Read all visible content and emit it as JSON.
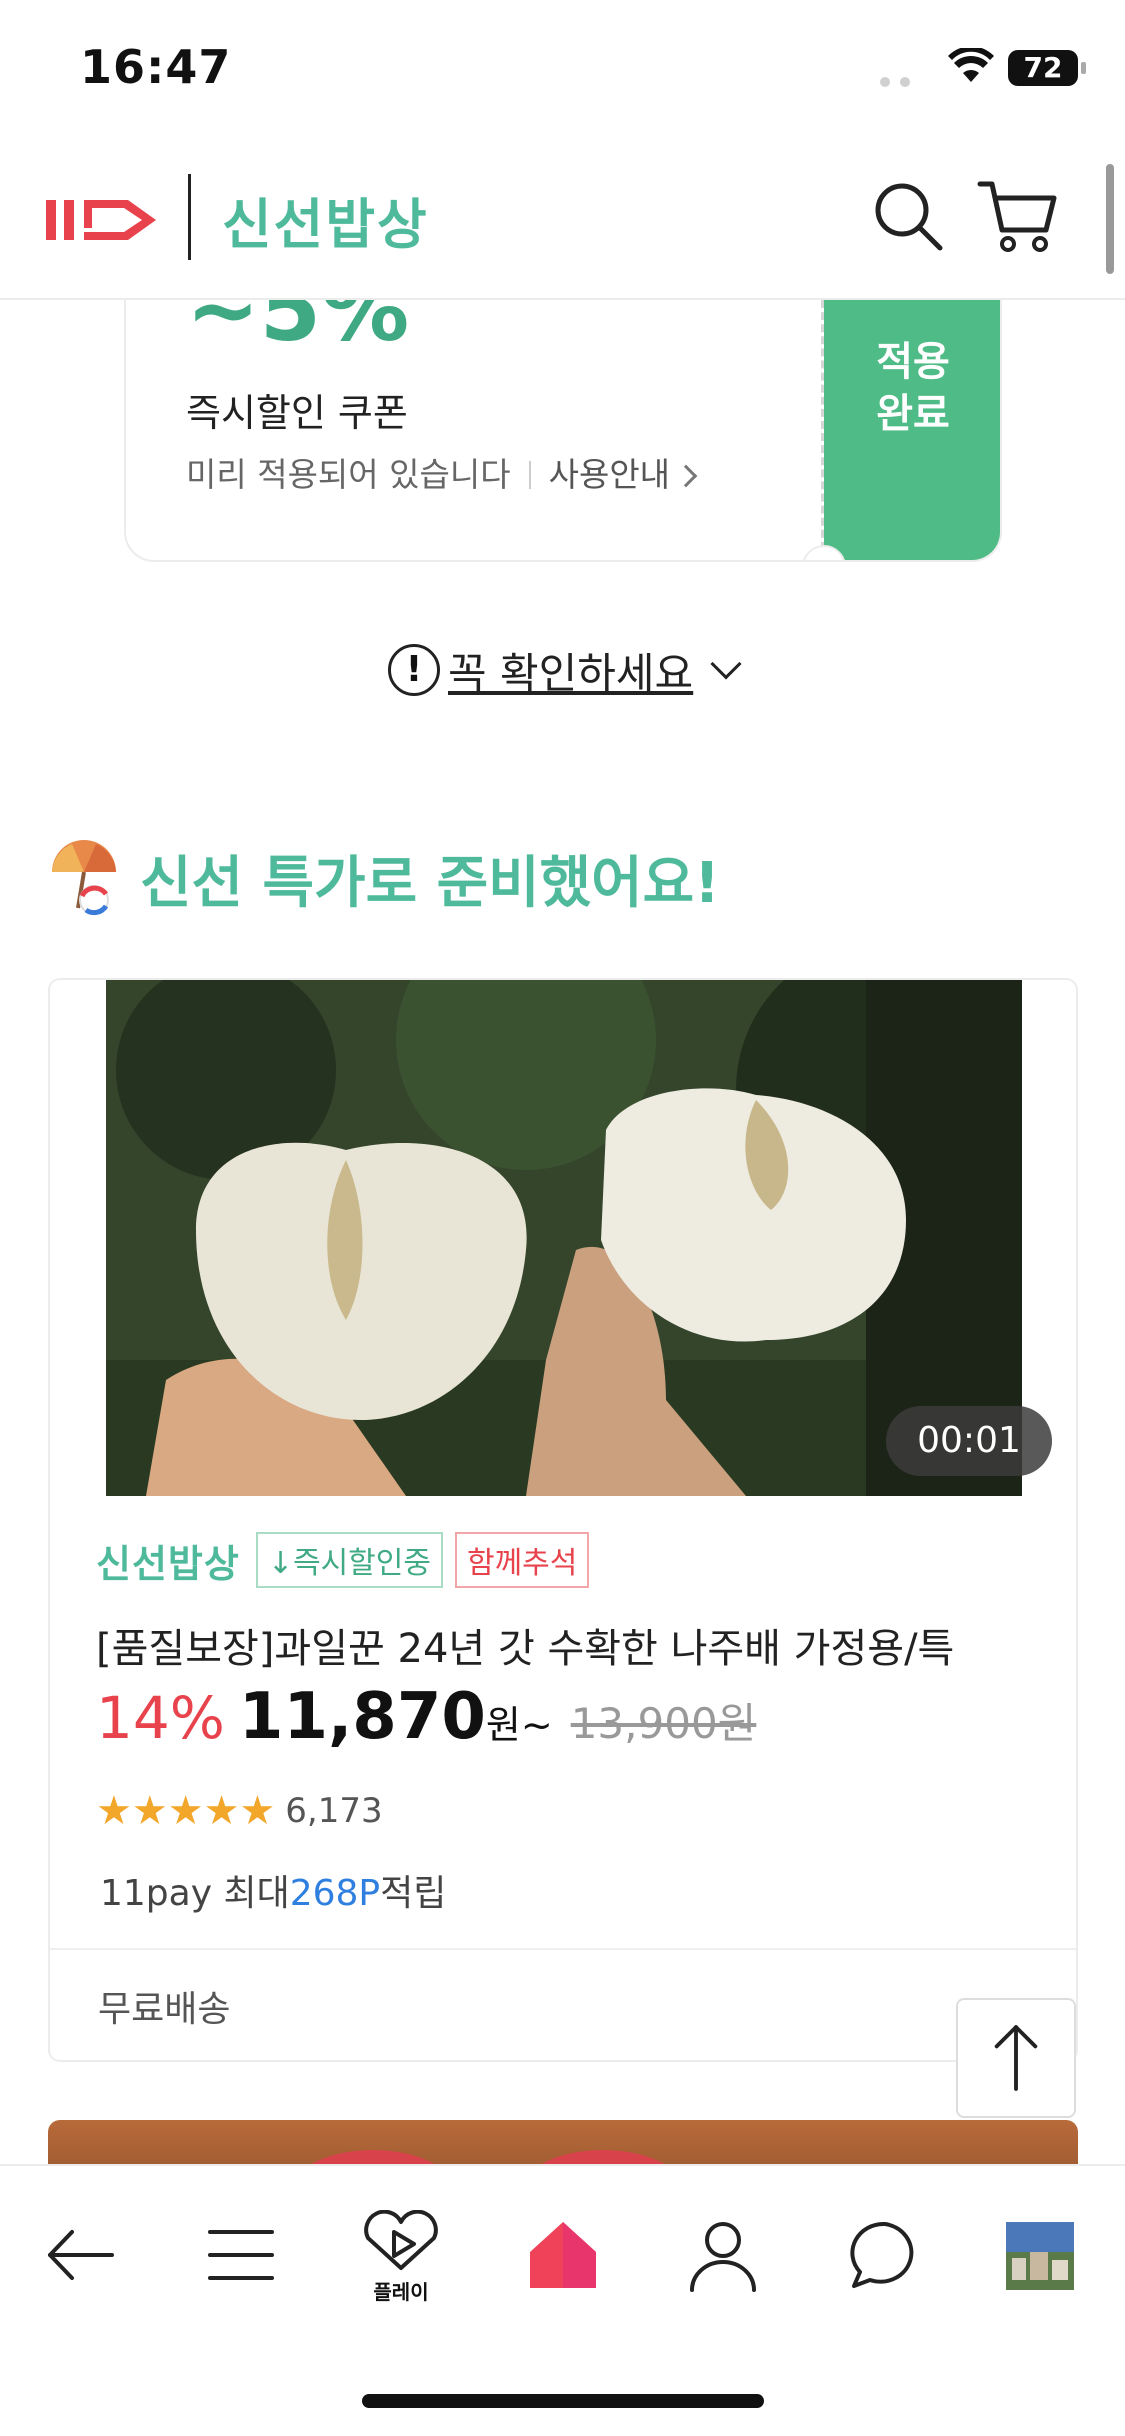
{
  "status_bar": {
    "time": "16:47",
    "battery": "72"
  },
  "header": {
    "brand": "신선밥상"
  },
  "coupon": {
    "percent": "~5%",
    "title": "즉시할인 쿠폰",
    "notice": "미리 적용되어 있습니다",
    "guide": "사용안내",
    "applied_line1": "적용",
    "applied_line2": "완료"
  },
  "check_notice": {
    "label": "꼭 확인하세요"
  },
  "section": {
    "title": "신선 특가로 준비했어요!"
  },
  "product": {
    "video_duration": "00:01",
    "store": "신선밥상",
    "tags": [
      "↓즉시할인중",
      "함께추석"
    ],
    "name": "[품질보장]과일꾼 24년 갓 수확한 나주배 가정용/특",
    "discount": "14%",
    "price": "11,870",
    "price_unit": "원~",
    "original_price": "13,900원",
    "rating": 4.5,
    "stars": "★★★★★",
    "review_count": "6,173",
    "pay_prefix": "11pay 최대",
    "pay_points": "268P",
    "pay_suffix": "적립",
    "shipping": "무료배송"
  },
  "bottom_nav": {
    "items": [
      "back-icon",
      "menu-icon",
      "play-icon",
      "home-icon",
      "profile-icon",
      "chat-icon",
      "recent-thumbnail"
    ],
    "play_label": "플레이",
    "accent": "#f0435a"
  }
}
